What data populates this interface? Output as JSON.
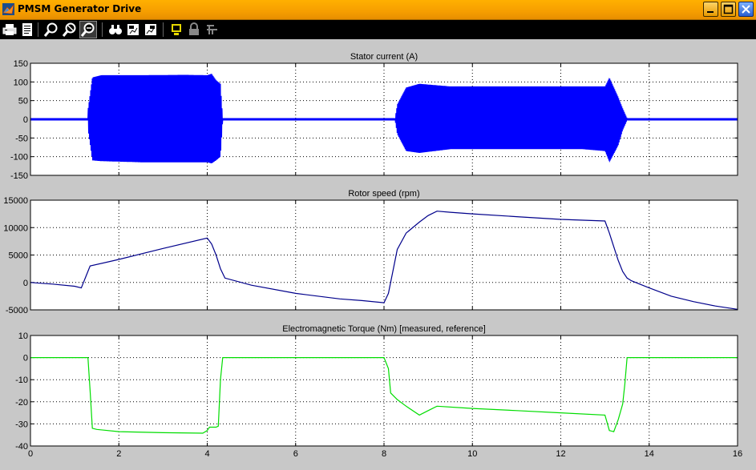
{
  "window": {
    "title": "PMSM Generator Drive"
  },
  "toolbar": {
    "buttons": [
      {
        "name": "print-icon"
      },
      {
        "name": "print-preview-icon"
      },
      {
        "name": "zoom-in-icon"
      },
      {
        "name": "zoom-out-icon"
      },
      {
        "name": "zoom-x-icon"
      },
      {
        "name": "autoscale-icon"
      },
      {
        "name": "save-axes-settings-icon"
      },
      {
        "name": "restore-axes-settings-icon"
      },
      {
        "name": "floating-scope-icon"
      },
      {
        "name": "lock-axes-icon"
      },
      {
        "name": "signal-selection-icon"
      }
    ]
  },
  "colors": {
    "current": "#0000ff",
    "speed": "#00008b",
    "torque": "#00dd00",
    "axes_bg": "#ffffff",
    "figure_bg": "#c8c8c8"
  },
  "chart_data": [
    {
      "type": "line",
      "title": "Stator current (A)",
      "xlim": [
        0,
        16
      ],
      "ylim": [
        -150,
        150
      ],
      "yticks": [
        150,
        100,
        50,
        0,
        -50,
        -100,
        -150
      ],
      "grid": true,
      "xticklabels_shown": false,
      "series": [
        {
          "x": [
            0,
            1.3,
            1.3,
            1.4,
            1.6,
            2.5,
            3.5,
            4.0,
            4.1,
            4.2,
            4.3,
            4.35,
            8.0,
            8.25
          ],
          "upper": [
            3,
            3,
            25,
            112,
            118,
            118,
            119,
            118,
            122,
            105,
            95,
            3,
            3,
            3
          ],
          "lower": [
            -3,
            -3,
            -25,
            -110,
            -112,
            -115,
            -115,
            -115,
            -118,
            -110,
            -100,
            -3,
            -3,
            -3
          ],
          "note": "dense oscillation envelope 1.3–4.35 s"
        },
        {
          "x": [
            8.25,
            8.3,
            8.5,
            8.8,
            9.5,
            11,
            12.5,
            13.0,
            13.1,
            13.3,
            13.4,
            13.5,
            16
          ],
          "upper": [
            3,
            40,
            85,
            95,
            88,
            88,
            88,
            88,
            112,
            60,
            30,
            3,
            3
          ],
          "lower": [
            -3,
            -40,
            -85,
            -90,
            -80,
            -80,
            -80,
            -85,
            -115,
            -70,
            -30,
            -3,
            -3
          ],
          "note": "dense oscillation envelope 8.25–13.5 s"
        }
      ]
    },
    {
      "type": "line",
      "title": "Rotor speed (rpm)",
      "xlim": [
        0,
        16
      ],
      "ylim": [
        -5000,
        15000
      ],
      "yticks": [
        15000,
        10000,
        5000,
        0,
        -5000
      ],
      "grid": true,
      "xticklabels_shown": false,
      "series": [
        {
          "x": [
            0,
            0.5,
            1.0,
            1.15,
            1.25,
            1.35,
            2,
            3,
            4.0,
            4.1,
            4.2,
            4.3,
            4.4,
            5,
            6,
            7,
            7.5,
            8.0,
            8.1,
            8.2,
            8.3,
            8.5,
            8.8,
            9.0,
            9.2,
            9.5,
            10,
            11,
            12,
            13.0,
            13.1,
            13.2,
            13.3,
            13.4,
            13.5,
            13.6,
            14,
            14.5,
            15,
            15.5,
            16
          ],
          "y": [
            0,
            -300,
            -700,
            -1000,
            1000,
            3000,
            4200,
            6200,
            8100,
            7000,
            5000,
            2500,
            800,
            -500,
            -2000,
            -3000,
            -3300,
            -3700,
            -2000,
            2000,
            6000,
            9000,
            11000,
            12200,
            13000,
            12800,
            12500,
            12000,
            11500,
            11200,
            9000,
            6500,
            4000,
            2000,
            800,
            300,
            -1000,
            -2500,
            -3500,
            -4300,
            -4900
          ]
        }
      ]
    },
    {
      "type": "line",
      "title": "Electromagnetic Torque (Nm)  [measured, reference]",
      "xlim": [
        0,
        16
      ],
      "ylim": [
        -40,
        10
      ],
      "yticks": [
        10,
        0,
        -10,
        -20,
        -30,
        -40
      ],
      "xticks": [
        0,
        2,
        4,
        6,
        8,
        10,
        12,
        14,
        16
      ],
      "xtick_labels": [
        "0",
        "2",
        "4",
        "6",
        "8",
        "10",
        "12",
        "14",
        "16"
      ],
      "grid": true,
      "series": [
        {
          "x": [
            0,
            1.3,
            1.35,
            1.4,
            1.5,
            2,
            3,
            3.9,
            4.0,
            4.05,
            4.2,
            4.25,
            4.3,
            4.35,
            8.0,
            8.1,
            8.15,
            8.3,
            8.5,
            8.8,
            9.0,
            9.2,
            10,
            11,
            12,
            13.0,
            13.1,
            13.2,
            13.3,
            13.4,
            13.45,
            13.5,
            16
          ],
          "y": [
            0,
            0,
            -15,
            -32,
            -32.5,
            -33.5,
            -34,
            -34.2,
            -33,
            -31.5,
            -31.5,
            -31,
            -10,
            0,
            0,
            -5,
            -16,
            -19,
            -22,
            -26,
            -24,
            -22,
            -23,
            -24,
            -25,
            -26,
            -33,
            -33.5,
            -28,
            -21,
            -12,
            0,
            0
          ]
        }
      ]
    }
  ]
}
